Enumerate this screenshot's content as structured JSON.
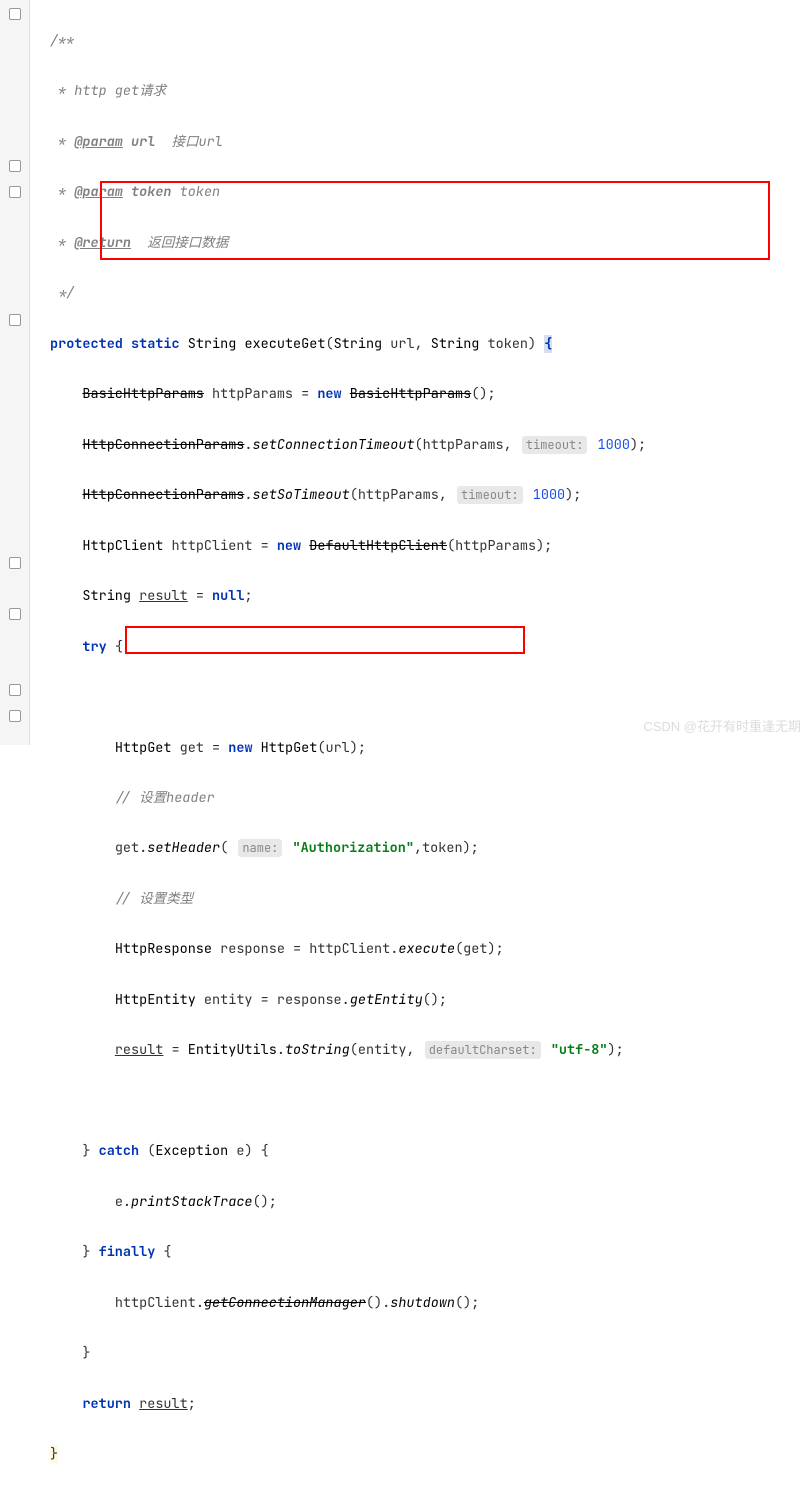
{
  "doc": {
    "open": "/**",
    "l1_pre": " * http get",
    "l1_zh": "请求",
    "l2_tag": "@param",
    "l2_name": "url",
    "l2_desc": "接口url",
    "l3_tag": "@param",
    "l3_name": "token",
    "l3_desc": "token",
    "l4_tag": "@return",
    "l4_desc": "返回接口数据",
    "close": " */"
  },
  "sig": {
    "k_protected": "protected",
    "k_static": "static",
    "t_string": "String",
    "name": "executeGet",
    "p1": "url",
    "p2": "token",
    "brace_open": "{"
  },
  "l8": {
    "cls": "BasicHttpParams",
    "var": "httpParams",
    "kw_new": "new",
    "ctor": "BasicHttpParams"
  },
  "l9": {
    "cls": "HttpConnectionParams",
    "m": "setConnectionTimeout",
    "arg1": "httpParams",
    "hint": "timeout:",
    "val": "1000"
  },
  "l10": {
    "cls": "HttpConnectionParams",
    "m": "setSoTimeout",
    "arg1": "httpParams",
    "hint": "timeout:",
    "val": "1000"
  },
  "l11": {
    "t": "HttpClient",
    "var": "httpClient",
    "kw_new": "new",
    "ctor": "DefaultHttpClient",
    "arg": "httpParams"
  },
  "l12": {
    "t": "String",
    "var": "result",
    "kw_null": "null"
  },
  "l13": {
    "kw_try": "try"
  },
  "l15": {
    "t": "HttpGet",
    "var": "get",
    "kw_new": "new",
    "ctor": "HttpGet",
    "arg": "url"
  },
  "l16": {
    "c": "// 设置header"
  },
  "l17": {
    "obj": "get",
    "m": "setHeader",
    "hint": "name:",
    "s": "\"Authorization\"",
    "arg2": "token"
  },
  "l18": {
    "c": "// 设置类型"
  },
  "l19": {
    "t": "HttpResponse",
    "var": "response",
    "obj": "httpClient",
    "m": "execute",
    "arg": "get"
  },
  "l20": {
    "t": "HttpEntity",
    "var": "entity",
    "obj": "response",
    "m": "getEntity"
  },
  "l21": {
    "var": "result",
    "cls": "EntityUtils",
    "m": "toString",
    "arg1": "entity",
    "hint": "defaultCharset:",
    "s": "\"utf-8\""
  },
  "l23": {
    "kw_catch": "catch",
    "t": "Exception",
    "var": "e"
  },
  "l24": {
    "obj": "e",
    "m": "printStackTrace"
  },
  "l25": {
    "kw_finally": "finally"
  },
  "l26": {
    "obj": "httpClient",
    "m1": "getConnectionManager",
    "m2": "shutdown"
  },
  "l28": {
    "kw_return": "return",
    "var": "result"
  },
  "l29": {
    "brace": "}"
  },
  "watermark": "CSDN @花开有时重逢无期"
}
